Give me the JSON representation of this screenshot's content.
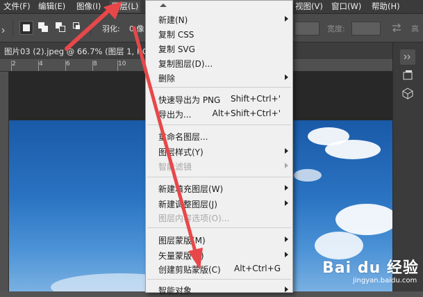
{
  "menubar": {
    "items": [
      "文件(F)",
      "编辑(E)",
      "图像(I)",
      "图层(L)",
      "视图(V)",
      "窗口(W)",
      "帮助(H)"
    ]
  },
  "options": {
    "feather_label": "羽化:",
    "feather_value": "0 像",
    "width_label": "宽度:"
  },
  "document": {
    "tab_title": "图片03 (2).jpeg @ 66.7% (图层 1, RG"
  },
  "ruler": {
    "labels": [
      "2",
      "4",
      "6",
      "8",
      "10"
    ]
  },
  "menu": {
    "items": [
      {
        "label": "新建(N)",
        "shortcut": "",
        "submenu": true,
        "disabled": false
      },
      {
        "label": "复制 CSS",
        "shortcut": "",
        "submenu": false,
        "disabled": false
      },
      {
        "label": "复制 SVG",
        "shortcut": "",
        "submenu": false,
        "disabled": false
      },
      {
        "label": "复制图层(D)...",
        "shortcut": "",
        "submenu": false,
        "disabled": false
      },
      {
        "label": "删除",
        "shortcut": "",
        "submenu": true,
        "disabled": false
      },
      {
        "label": "快速导出为 PNG",
        "shortcut": "Shift+Ctrl+'",
        "submenu": false,
        "disabled": false
      },
      {
        "label": "导出为...",
        "shortcut": "Alt+Shift+Ctrl+'",
        "submenu": false,
        "disabled": false
      },
      {
        "label": "重命名图层...",
        "shortcut": "",
        "submenu": false,
        "disabled": false
      },
      {
        "label": "图层样式(Y)",
        "shortcut": "",
        "submenu": true,
        "disabled": false
      },
      {
        "label": "智能滤镜",
        "shortcut": "",
        "submenu": true,
        "disabled": true
      },
      {
        "label": "新建填充图层(W)",
        "shortcut": "",
        "submenu": true,
        "disabled": false
      },
      {
        "label": "新建调整图层(J)",
        "shortcut": "",
        "submenu": true,
        "disabled": false
      },
      {
        "label": "图层内容选项(O)...",
        "shortcut": "",
        "submenu": false,
        "disabled": true
      },
      {
        "label": "图层蒙版(M)",
        "shortcut": "",
        "submenu": true,
        "disabled": false
      },
      {
        "label": "矢量蒙版(V)",
        "shortcut": "",
        "submenu": true,
        "disabled": false
      },
      {
        "label": "创建剪贴蒙版(C)",
        "shortcut": "Alt+Ctrl+G",
        "submenu": false,
        "disabled": false
      },
      {
        "label": "智能对象",
        "shortcut": "",
        "submenu": true,
        "disabled": false
      }
    ]
  },
  "watermark": {
    "brand": "Bai du 经验",
    "site": "jingyan.baidu.com"
  },
  "colors": {
    "arrow": "#e8474a",
    "menu_bg": "#f0f0f0",
    "menubar_bg": "#3b3b3b"
  }
}
